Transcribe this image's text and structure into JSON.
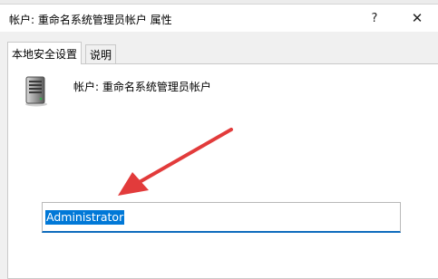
{
  "window": {
    "title": "帐户: 重命名系统管理员帐户 属性",
    "help_symbol": "?",
    "close_symbol": "✕"
  },
  "tabs": [
    {
      "label": "本地安全设置",
      "active": true
    },
    {
      "label": "说明",
      "active": false
    }
  ],
  "panel": {
    "account_label": "帐户: 重命名系统管理员帐户",
    "input_value": "Administrator"
  },
  "icons": {
    "policy": "server-icon",
    "annotation": "red-arrow-icon"
  },
  "colors": {
    "selection": "#0078d7",
    "focus_border": "#0f6cbd",
    "annotation_arrow": "#e23b3b"
  }
}
